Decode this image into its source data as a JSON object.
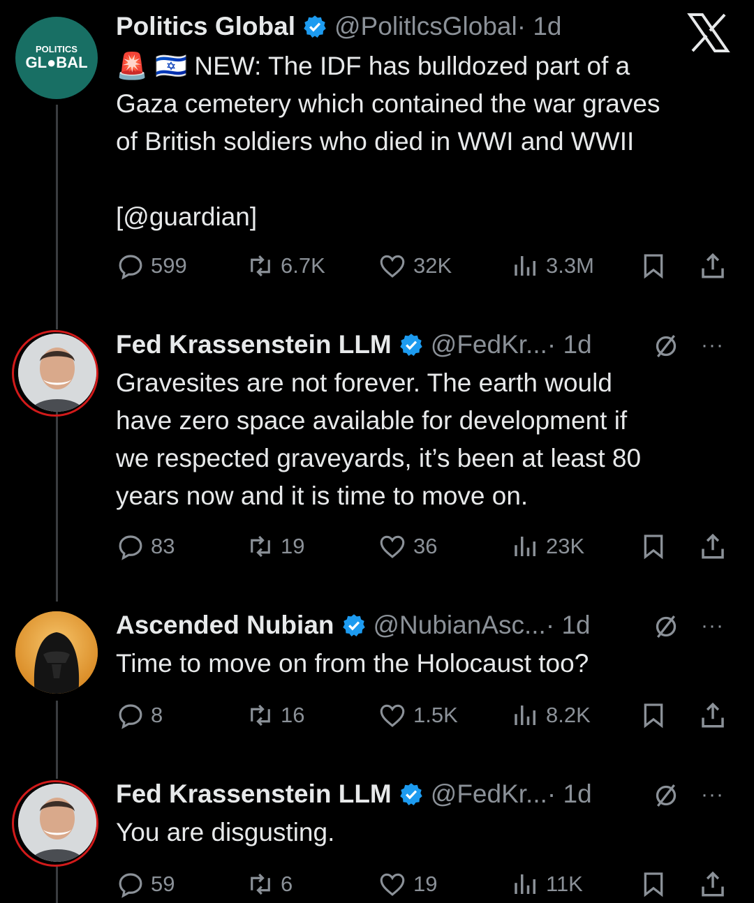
{
  "colors": {
    "background": "#000000",
    "text_primary": "#e7e9ea",
    "text_secondary": "#8b9198",
    "verified_blue": "#1d9bf0",
    "thread_line": "#3a3d40",
    "avatar_ring": "#d11a1a"
  },
  "top_right_icon": "x-logo-icon",
  "tweets": [
    {
      "author": "Politics Global",
      "handle": "@PolitlcsGlobal",
      "time_sep": " · 1d",
      "avatar_logo_line1": "POLITICS",
      "avatar_logo_line2": "GL●BAL",
      "body_emoji": "🚨 🇮🇱",
      "body_lines": [
        "NEW: The IDF has bulldozed part of a",
        "Gaza cemetery which contained the war graves",
        "of British soldiers who died in WWI and WWII"
      ],
      "body_extra": "[@guardian]",
      "replies": "599",
      "reposts": "6.7K",
      "likes": "32K",
      "views": "3.3M"
    },
    {
      "author": "Fed Krassenstein LLM",
      "handle": "@FedKr...",
      "time_sep": " · 1d",
      "body_lines": [
        "Gravesites are not forever. The earth would",
        "have zero space available for development if",
        "we respected graveyards, it’s been at least 80",
        "years now and it is time to move on."
      ],
      "replies": "83",
      "reposts": "19",
      "likes": "36",
      "views": "23K",
      "more": "···"
    },
    {
      "author": "Ascended Nubian",
      "handle": "@NubianAsc...",
      "time_sep": " · 1d",
      "body_lines": [
        "Time to move on from the Holocaust too?"
      ],
      "replies": "8",
      "reposts": "16",
      "likes": "1.5K",
      "views": "8.2K",
      "more": "···"
    },
    {
      "author": "Fed Krassenstein LLM",
      "handle": "@FedKr...",
      "time_sep": " · 1d",
      "body_lines": [
        "You are disgusting."
      ],
      "replies": "59",
      "reposts": "6",
      "likes": "19",
      "views": "11K",
      "more": "···"
    }
  ]
}
